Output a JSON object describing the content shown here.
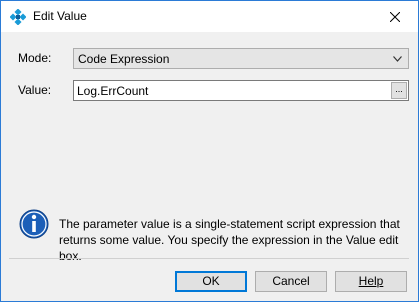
{
  "window": {
    "title": "Edit Value"
  },
  "form": {
    "mode_label": "Mode:",
    "mode_value": "Code Expression",
    "value_label": "Value:",
    "value_value": "Log.ErrCount",
    "ellipsis_label": "..."
  },
  "info": {
    "text": "The parameter value is a single-statement script expression that returns some value. You specify the expression in the Value edit box."
  },
  "buttons": {
    "ok": "OK",
    "cancel": "Cancel",
    "help": "Help"
  },
  "colors": {
    "window_border": "#2b7bd6",
    "info_blue": "#1c5fb8",
    "default_button_border": "#0078d7"
  }
}
